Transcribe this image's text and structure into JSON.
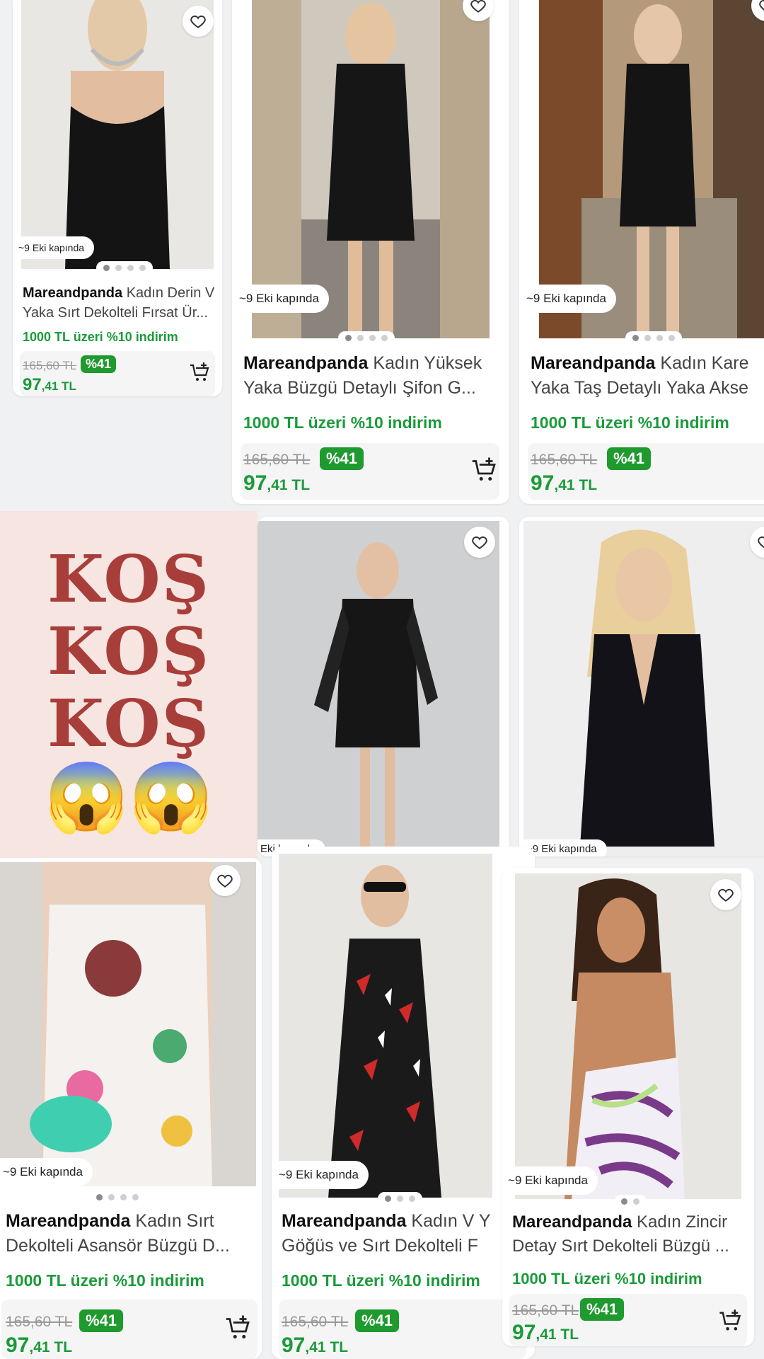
{
  "products": [
    {
      "brand": "Mareandpanda",
      "name": "Kadın Derin V Yaka Sırt Dekolteli Fırsat Ür...",
      "shipping": "~9 Eki kapında",
      "promo": "1000 TL üzeri %10 indirim",
      "old_price": "165,60 TL",
      "discount": "%41",
      "price_int": "97",
      "price_dec": ",41 TL",
      "image_count": 4,
      "active_image": 1
    },
    {
      "brand": "Mareandpanda",
      "name": "Kadın Yüksek Yaka Büzgü Detaylı Şifon G...",
      "shipping": "~9 Eki kapında",
      "promo": "1000 TL üzeri %10 indirim",
      "old_price": "165,60 TL",
      "discount": "%41",
      "price_int": "97",
      "price_dec": ",41 TL",
      "image_count": 4,
      "active_image": 1
    },
    {
      "brand": "Mareandpanda",
      "name": "Kadın Kare Yaka Taş Detaylı Yaka Akse",
      "shipping": "~9 Eki kapında",
      "promo": "1000 TL üzeri %10 indirim",
      "old_price": "165,60 TL",
      "discount": "%41",
      "price_int": "97",
      "price_dec": ",41 TL",
      "image_count": 4,
      "active_image": 1
    },
    {
      "shipping": "Eki kapında"
    },
    {
      "shipping": "~9 Eki kapında"
    },
    {
      "brand": "Mareandpanda",
      "name": "Kadın Sırt Dekolteli Asansör Büzgü D...",
      "shipping": "~9 Eki kapında",
      "promo": "1000 TL üzeri %10 indirim",
      "old_price": "165,60 TL",
      "discount": "%41",
      "price_int": "97",
      "price_dec": ",41 TL",
      "image_count": 4,
      "active_image": 1
    },
    {
      "brand": "Mareandpanda",
      "name": "Kadın V Y Göğüs ve Sırt Dekolteli F",
      "shipping": "~9 Eki kapında",
      "promo": "1000 TL üzeri %10 indirim",
      "old_price": "165,60 TL",
      "discount": "%41",
      "price_int": "97",
      "price_dec": ",41 TL",
      "image_count": 3,
      "active_image": 1
    },
    {
      "brand": "Mareandpanda",
      "name": "Kadın Zincir Detay Sırt Dekolteli Büzgü ...",
      "shipping": "~9 Eki kapında",
      "promo": "1000 TL üzeri %10 indirim",
      "old_price": "165,60 TL",
      "discount": "%41",
      "price_int": "97",
      "price_dec": ",41 TL",
      "image_count": 2,
      "active_image": 1
    }
  ],
  "banner": {
    "lines": [
      "KOŞ",
      "KOŞ",
      "KOŞ"
    ],
    "emoji": "😱😱"
  },
  "colors": {
    "accent_green": "#1a9b3a",
    "badge_green": "#1f9a2f",
    "banner_bg": "#f7e5e2",
    "banner_text": "#a83e3a"
  },
  "icons": {
    "favorite": "heart-icon",
    "cart": "add-to-cart-icon"
  }
}
